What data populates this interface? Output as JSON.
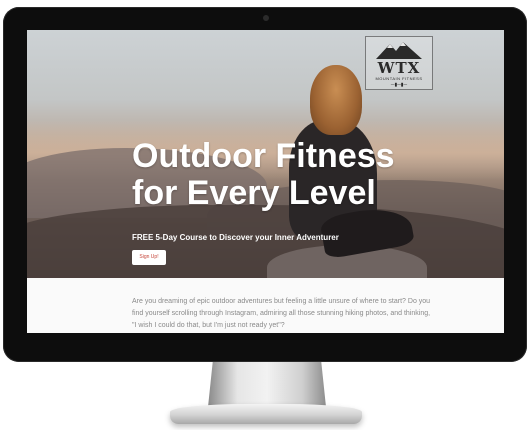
{
  "logo": {
    "text": "WTX",
    "subtitle": "MOUNTAIN FITNESS"
  },
  "hero": {
    "headline_line1": "Outdoor Fitness",
    "headline_line2": "for Every Level",
    "subheadline": "FREE 5-Day Course to Discover your Inner Adventurer",
    "cta_label": "Sign Up!"
  },
  "body": {
    "intro_text": "Are you dreaming of epic outdoor adventures but feeling a little unsure of where to start? Do you find yourself scrolling through Instagram, admiring all those stunning hiking photos, and thinking, \"I wish I could do that, but I'm just not ready yet\"?"
  },
  "colors": {
    "cta_text": "#c6473b",
    "headline": "#ffffff",
    "body_text": "#8a8a8a"
  },
  "icons": [
    "mountain-icon",
    "dumbbell-icon"
  ]
}
